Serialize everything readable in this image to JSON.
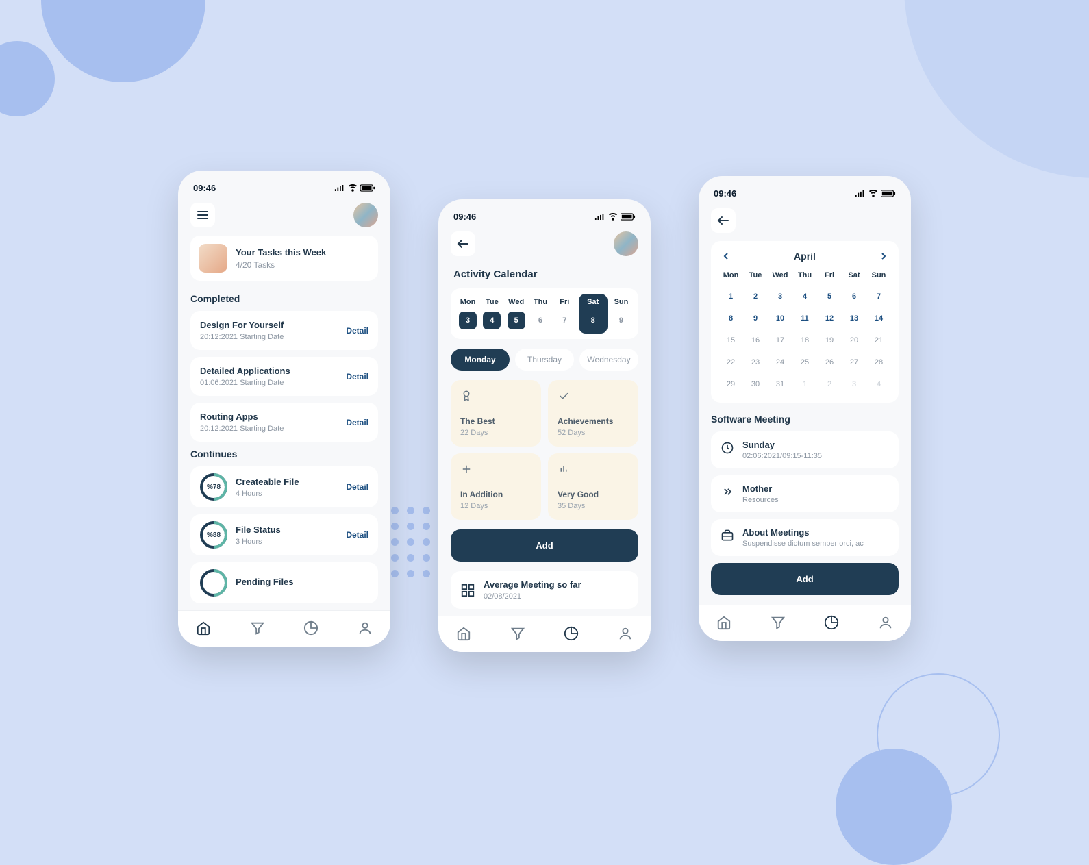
{
  "statusbar": {
    "time": "09:46"
  },
  "screen1": {
    "banner": {
      "title": "Your Tasks this Week",
      "subtitle": "4/20 Tasks"
    },
    "completed": {
      "heading": "Completed",
      "detail_label": "Detail",
      "items": [
        {
          "title": "Design For Yourself",
          "sub": "20:12:2021 Starting Date"
        },
        {
          "title": "Detailed Applications",
          "sub": "01:06:2021 Starting Date"
        },
        {
          "title": "Routing Apps",
          "sub": "20:12:2021 Starting Date"
        }
      ]
    },
    "continues": {
      "heading": "Continues",
      "detail_label": "Detail",
      "items": [
        {
          "pct": "%78",
          "title": "Createable File",
          "sub": "4 Hours"
        },
        {
          "pct": "%88",
          "title": "File Status",
          "sub": "3 Hours"
        },
        {
          "pct": "",
          "title": "Pending Files",
          "sub": ""
        }
      ]
    }
  },
  "screen2": {
    "title": "Activity Calendar",
    "week": [
      {
        "label": "Mon",
        "num": "3",
        "filled": true
      },
      {
        "label": "Tue",
        "num": "4",
        "filled": true
      },
      {
        "label": "Wed",
        "num": "5",
        "filled": true
      },
      {
        "label": "Thu",
        "num": "6",
        "filled": false
      },
      {
        "label": "Fri",
        "num": "7",
        "filled": false
      },
      {
        "label": "Sat",
        "num": "8",
        "filled": false,
        "selected": true
      },
      {
        "label": "Sun",
        "num": "9",
        "filled": false
      }
    ],
    "pills": [
      "Monday",
      "Thursday",
      "Wednesday"
    ],
    "tiles": [
      {
        "title": "The Best",
        "sub": "22 Days",
        "icon": "award"
      },
      {
        "title": "Achievements",
        "sub": "52 Days",
        "icon": "check"
      },
      {
        "title": "In Addition",
        "sub": "12 Days",
        "icon": "plus"
      },
      {
        "title": "Very Good",
        "sub": "35 Days",
        "icon": "bars"
      }
    ],
    "add_label": "Add",
    "avg": {
      "title": "Average Meeting so far",
      "sub": "02/08/2021"
    }
  },
  "screen3": {
    "month": "April",
    "dow": [
      "Mon",
      "Tue",
      "Wed",
      "Thu",
      "Fri",
      "Sat",
      "Sun"
    ],
    "weeks": [
      [
        {
          "n": "1",
          "r": true
        },
        {
          "n": "2",
          "r": true
        },
        {
          "n": "3",
          "r": true
        },
        {
          "n": "4",
          "r": true
        },
        {
          "n": "5",
          "r": true
        },
        {
          "n": "6",
          "r": true
        },
        {
          "n": "7",
          "r": true
        }
      ],
      [
        {
          "n": "8",
          "r": true
        },
        {
          "n": "9",
          "r": true
        },
        {
          "n": "10",
          "r": true
        },
        {
          "n": "11",
          "r": true
        },
        {
          "n": "12",
          "r": true
        },
        {
          "n": "13",
          "r": true
        },
        {
          "n": "14",
          "r": true
        }
      ],
      [
        {
          "n": "15"
        },
        {
          "n": "16"
        },
        {
          "n": "17"
        },
        {
          "n": "18"
        },
        {
          "n": "19"
        },
        {
          "n": "20"
        },
        {
          "n": "21"
        }
      ],
      [
        {
          "n": "22"
        },
        {
          "n": "23"
        },
        {
          "n": "24"
        },
        {
          "n": "25"
        },
        {
          "n": "26"
        },
        {
          "n": "27"
        },
        {
          "n": "28"
        }
      ],
      [
        {
          "n": "29"
        },
        {
          "n": "30"
        },
        {
          "n": "31"
        },
        {
          "n": "1",
          "d": true
        },
        {
          "n": "2",
          "d": true
        },
        {
          "n": "3",
          "d": true
        },
        {
          "n": "4",
          "d": true
        }
      ]
    ],
    "section_title": "Software Meeting",
    "cards": [
      {
        "icon": "clock",
        "title": "Sunday",
        "sub": "02:06:2021/09:15-11:35"
      },
      {
        "icon": "chevrons",
        "title": "Mother",
        "sub": "Resources"
      },
      {
        "icon": "briefcase",
        "title": "About Meetings",
        "sub": "Suspendisse dictum semper orci, ac"
      }
    ],
    "add_label": "Add"
  }
}
